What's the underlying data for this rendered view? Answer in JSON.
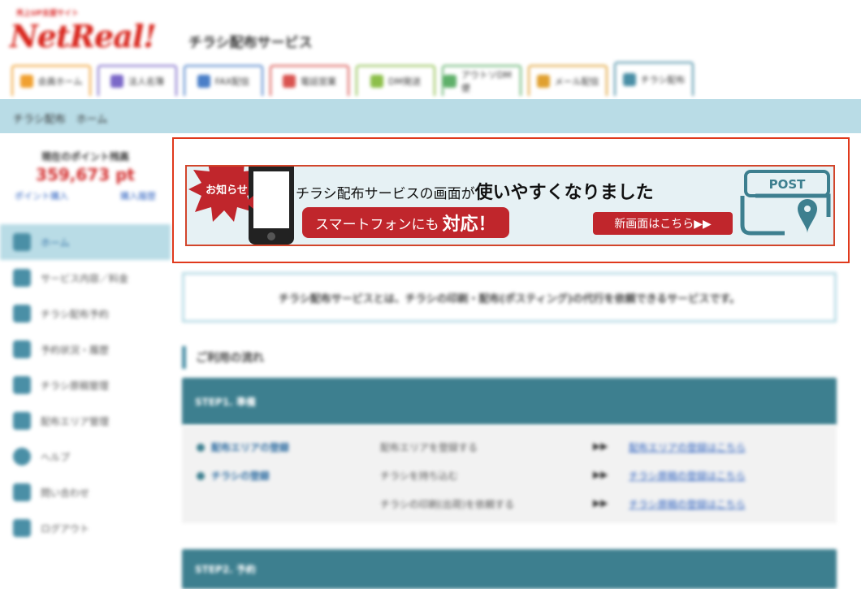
{
  "header": {
    "logo_tagline": "売上UP支援サイト",
    "logo_text": "NetReal!",
    "service_title": "チラシ配布サービス",
    "tabs": [
      {
        "label": "会員ホーム",
        "color": "#f0a030",
        "icon": "home-icon"
      },
      {
        "label": "法人名簿",
        "color": "#7b68c8",
        "icon": "book-icon"
      },
      {
        "label": "FAX配信",
        "color": "#4a7fc8",
        "icon": "fax-icon"
      },
      {
        "label": "電話営業",
        "color": "#d9534f",
        "icon": "phone-icon"
      },
      {
        "label": "DM発送",
        "color": "#8cbf4a",
        "icon": "dm-icon"
      },
      {
        "label": "アウトソDM便",
        "color": "#5fb06a",
        "icon": "truck-icon"
      },
      {
        "label": "メール配信",
        "color": "#e0a030",
        "icon": "mail-icon"
      },
      {
        "label": "チラシ配布",
        "color": "#4a8fa6",
        "icon": "flyer-icon",
        "active": true
      }
    ]
  },
  "breadcrumb": "チラシ配布　ホーム",
  "sidebar": {
    "points_label": "現在のポイント残高",
    "points_value": "359,673 pt",
    "buy_link": "ポイント購入",
    "history_link": "購入履歴",
    "menu": [
      {
        "label": "ホーム",
        "active": true,
        "icon": "home-icon"
      },
      {
        "label": "サービス内容／料金",
        "icon": "document-icon"
      },
      {
        "label": "チラシ配布予約",
        "icon": "pin-icon"
      },
      {
        "label": "予約状況・履歴",
        "icon": "calendar-icon"
      },
      {
        "label": "チラシ原稿管理",
        "icon": "file-icon"
      },
      {
        "label": "配布エリア管理",
        "icon": "map-icon"
      },
      {
        "label": "ヘルプ",
        "icon": "help-icon"
      },
      {
        "label": "問い合わせ",
        "icon": "contact-icon"
      },
      {
        "label": "ログアウト",
        "icon": "logout-icon"
      }
    ]
  },
  "banner": {
    "badge": "お知らせ",
    "headline_small": "チラシ配布サービスの画面が",
    "headline_big": "使いやすくなりました",
    "pill_small": "スマートフォンにも",
    "pill_big": "対応！",
    "cta": "新画面はこちら▶▶",
    "post_label": "POST"
  },
  "intro_text": "チラシ配布サービスとは、チラシの印刷・配布(ポスティング)の代行を依頼できるサービスです。",
  "flow": {
    "title": "ご利用の流れ",
    "step1": "STEP1. 準備",
    "step2": "STEP2. 予約",
    "rows": [
      {
        "item": "配布エリアの登録",
        "desc": "配布エリアを登録する",
        "arrow": "▶▶",
        "link": "配布エリアの登録はこちら"
      },
      {
        "item": "チラシの登録",
        "desc": "チラシを持ち込む",
        "arrow": "▶▶",
        "link": "チラシ原稿の登録はこちら"
      },
      {
        "item": "",
        "desc": "チラシの印刷(出荷)を依頼する",
        "arrow": "▶▶",
        "link": "チラシ原稿の登録はこちら"
      }
    ]
  },
  "colors": {
    "accent": "#3d7f8f",
    "banner_red": "#c0262c",
    "frame": "#e0391c"
  }
}
